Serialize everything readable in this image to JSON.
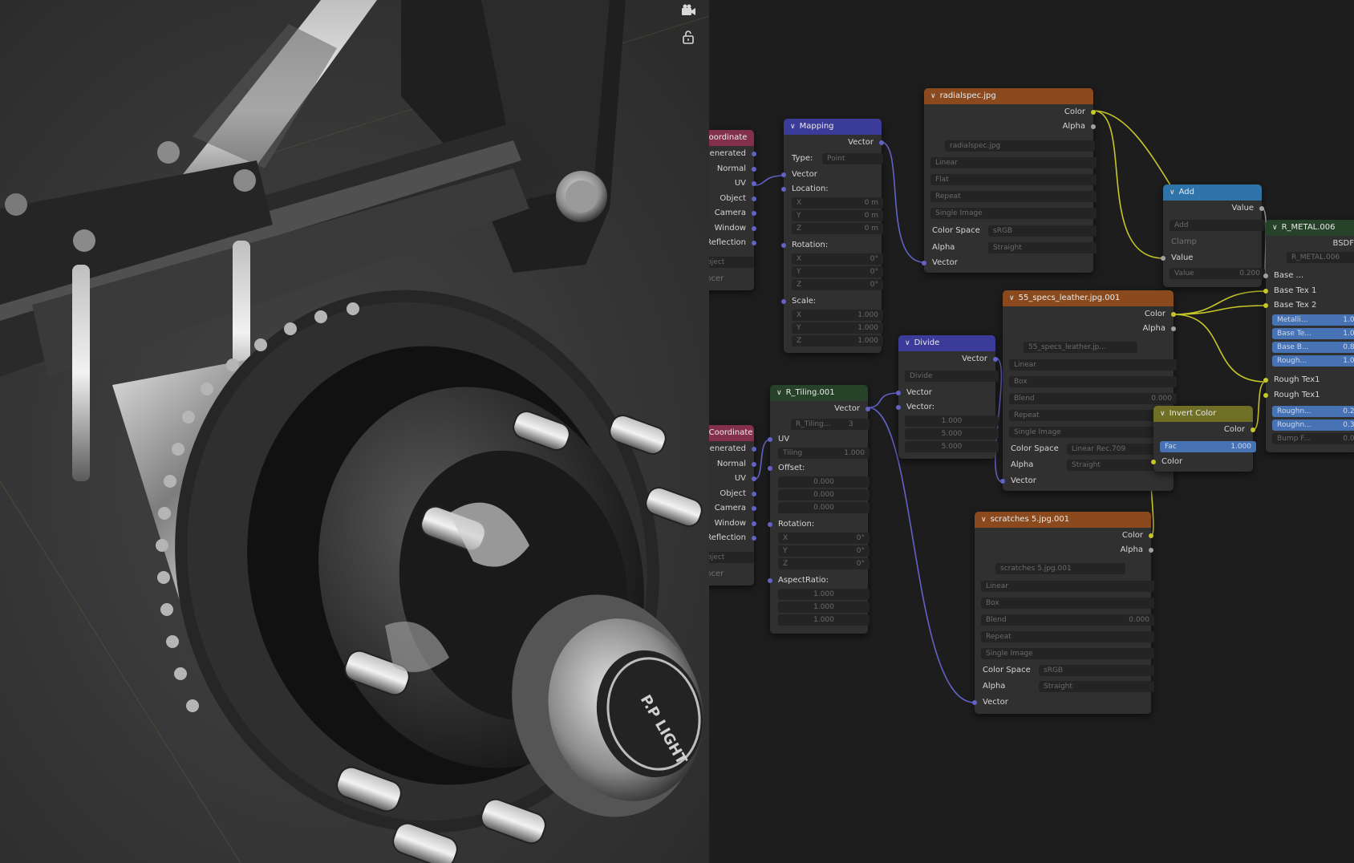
{
  "viewport": {
    "icons": [
      "camera-icon",
      "lock-icon"
    ],
    "emblem_text": "P.P LIGHT"
  },
  "nodes": {
    "tex_coord_top": {
      "title": "oordinate",
      "outputs": [
        "Generated",
        "Normal",
        "UV",
        "Object",
        "Camera",
        "Window",
        "Reflection"
      ],
      "object_field": "Object",
      "instancer": "ancer"
    },
    "mapping": {
      "title": "Mapping",
      "output": "Vector",
      "type_label": "Type:",
      "type_value": "Point",
      "vector_label": "Vector",
      "location_label": "Location:",
      "location": [
        [
          "X",
          "0 m"
        ],
        [
          "Y",
          "0 m"
        ],
        [
          "Z",
          "0 m"
        ]
      ],
      "rotation_label": "Rotation:",
      "rotation": [
        [
          "X",
          "0°"
        ],
        [
          "Y",
          "0°"
        ],
        [
          "Z",
          "0°"
        ]
      ],
      "scale_label": "Scale:",
      "scale": [
        [
          "X",
          "1.000"
        ],
        [
          "Y",
          "1.000"
        ],
        [
          "Z",
          "1.000"
        ]
      ]
    },
    "radialspec": {
      "title": "radialspec.jpg",
      "outputs": [
        "Color",
        "Alpha"
      ],
      "image_name": "radialspec.jpg",
      "options": [
        "Linear",
        "Flat",
        "Repeat",
        "Single Image"
      ],
      "color_space_label": "Color Space",
      "color_space_value": "sRGB",
      "alpha_label": "Alpha",
      "alpha_value": "Straight",
      "input": "Vector"
    },
    "add": {
      "title": "Add",
      "output": "Value",
      "operation": "Add",
      "clamp": "Clamp",
      "value_label": "Value",
      "value_field_label": "Value",
      "value_field_value": "0.200"
    },
    "rmetal": {
      "title": "R_METAL.006",
      "output": "BSDF",
      "group_name": "R_METAL.006",
      "rows": [
        "Base ...",
        "Base Tex 1",
        "Base Tex 2"
      ],
      "fields": [
        [
          "Metalli...",
          "1.000"
        ],
        [
          "Base Te...",
          "1.000"
        ],
        [
          "Base B...",
          "0.850"
        ],
        [
          "Rough...",
          "1.000"
        ]
      ],
      "rows2": [
        "Rough Tex1",
        "Rough Tex1"
      ],
      "fields2": [
        [
          "Roughn...",
          "0.240"
        ],
        [
          "Roughn...",
          "0.350"
        ],
        [
          "Bump F...",
          "0.016"
        ]
      ]
    },
    "leather": {
      "title": "55_specs_leather.jpg.001",
      "outputs": [
        "Color",
        "Alpha"
      ],
      "image_name": "55_specs_leather.jp...",
      "options": [
        "Linear",
        "Box"
      ],
      "blend_label": "Blend",
      "blend_value": "0.000",
      "options2": [
        "Repeat",
        "Single Image"
      ],
      "color_space_label": "Color Space",
      "color_space_value": "Linear Rec.709",
      "alpha_label": "Alpha",
      "alpha_value": "Straight",
      "input": "Vector"
    },
    "divide": {
      "title": "Divide",
      "output": "Vector",
      "operation": "Divide",
      "inputs": [
        "Vector",
        "Vector:"
      ],
      "values": [
        "1.000",
        "5.000",
        "5.000"
      ]
    },
    "rtiling": {
      "title": "R_Tiling.001",
      "output": "Vector",
      "group_name": "R_Tiling...",
      "users": "3",
      "uv_label": "UV",
      "tiling_label": "Tiling",
      "tiling_value": "1.000",
      "offset_label": "Offset:",
      "offset": [
        "0.000",
        "0.000",
        "0.000"
      ],
      "rotation_label": "Rotation:",
      "rotation": [
        [
          "X",
          "0°"
        ],
        [
          "Y",
          "0°"
        ],
        [
          "Z",
          "0°"
        ]
      ],
      "aspect_label": "AspectRatio:",
      "aspect": [
        "1.000",
        "1.000",
        "1.000"
      ]
    },
    "invert": {
      "title": "Invert Color",
      "output": "Color",
      "fac_label": "Fac",
      "fac_value": "1.000",
      "input": "Color"
    },
    "tex_coord_bottom": {
      "title": "Coordinate",
      "outputs": [
        "Generated",
        "Normal",
        "UV",
        "Object",
        "Camera",
        "Window",
        "Reflection"
      ],
      "object_field": "Object",
      "instancer": "ancer"
    },
    "scratches": {
      "title": "scratches 5.jpg.001",
      "outputs": [
        "Color",
        "Alpha"
      ],
      "image_name": "scratches 5.jpg.001",
      "options": [
        "Linear",
        "Box"
      ],
      "blend_label": "Blend",
      "blend_value": "0.000",
      "options2": [
        "Repeat",
        "Single Image"
      ],
      "color_space_label": "Color Space",
      "color_space_value": "sRGB",
      "alpha_label": "Alpha",
      "alpha_value": "Straight",
      "input": "Vector"
    }
  }
}
